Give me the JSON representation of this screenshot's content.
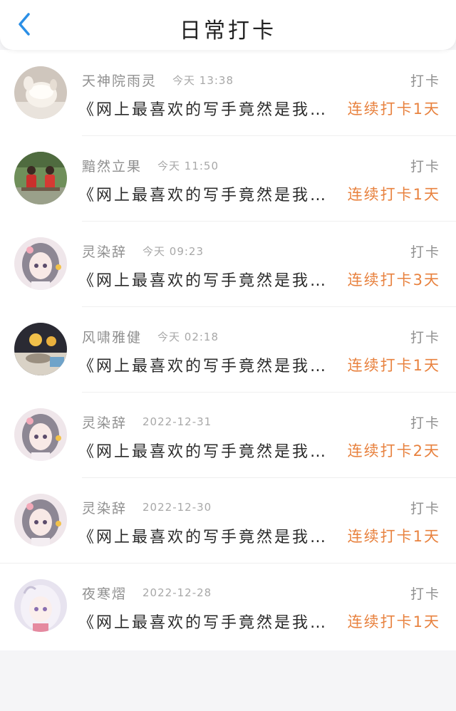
{
  "header": {
    "title": "日常打卡",
    "back_icon": "chevron-left-icon",
    "accent_color": "#2b8fe6"
  },
  "colors": {
    "streak": "#e8823f",
    "meta": "#8f8f8f"
  },
  "checkins": [
    {
      "name": "天神院雨灵",
      "time": "今天 13:38",
      "action": "打卡",
      "book": "《网上最喜欢的写手竟然是我…",
      "streak": "连续打卡1天",
      "avatar": "cat-cup-avatar"
    },
    {
      "name": "黯然立果",
      "time": "今天 11:50",
      "action": "打卡",
      "book": "《网上最喜欢的写手竟然是我…",
      "streak": "连续打卡1天",
      "avatar": "two-figures-avatar"
    },
    {
      "name": "灵染辞",
      "time": "今天 09:23",
      "action": "打卡",
      "book": "《网上最喜欢的写手竟然是我…",
      "streak": "连续打卡3天",
      "avatar": "anime-girl-avatar"
    },
    {
      "name": "风啸雅健",
      "time": "今天 02:18",
      "action": "打卡",
      "book": "《网上最喜欢的写手竟然是我…",
      "streak": "连续打卡1天",
      "avatar": "night-lights-avatar"
    },
    {
      "name": "灵染辞",
      "time": "2022-12-31",
      "action": "打卡",
      "book": "《网上最喜欢的写手竟然是我…",
      "streak": "连续打卡2天",
      "avatar": "anime-girl-avatar"
    },
    {
      "name": "灵染辞",
      "time": "2022-12-30",
      "action": "打卡",
      "book": "《网上最喜欢的写手竟然是我…",
      "streak": "连续打卡1天",
      "avatar": "anime-girl-avatar"
    },
    {
      "name": "夜寒熠",
      "time": "2022-12-28",
      "action": "打卡",
      "book": "《网上最喜欢的写手竟然是我…",
      "streak": "连续打卡1天",
      "avatar": "white-hair-girl-avatar"
    }
  ]
}
